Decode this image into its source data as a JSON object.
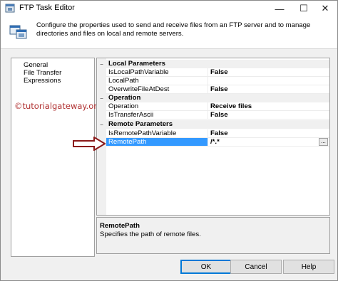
{
  "window": {
    "title": "FTP Task Editor",
    "minimize_glyph": "—",
    "maximize_glyph": "☐",
    "close_glyph": "✕"
  },
  "header": {
    "description": "Configure the properties used to send and receive files from an FTP server and to manage directories and files on local and remote servers."
  },
  "nav": {
    "items": [
      {
        "label": "General"
      },
      {
        "label": "File Transfer"
      },
      {
        "label": "Expressions"
      }
    ]
  },
  "watermark": "©tutorialgateway.org",
  "grid": {
    "categories": [
      {
        "label": "Local Parameters",
        "toggle": "−",
        "props": [
          {
            "name": "IsLocalPathVariable",
            "value": "False"
          },
          {
            "name": "LocalPath",
            "value": ""
          },
          {
            "name": "OverwriteFileAtDest",
            "value": "False"
          }
        ]
      },
      {
        "label": "Operation",
        "toggle": "−",
        "props": [
          {
            "name": "Operation",
            "value": "Receive files"
          },
          {
            "name": "IsTransferAscii",
            "value": "False"
          }
        ]
      },
      {
        "label": "Remote Parameters",
        "toggle": "−",
        "props": [
          {
            "name": "IsRemotePathVariable",
            "value": "False"
          },
          {
            "name": "RemotePath",
            "value": "/*.*",
            "selected": true,
            "ellipsis": "..."
          }
        ]
      }
    ]
  },
  "description_pane": {
    "title": "RemotePath",
    "text": "Specifies the path of remote files."
  },
  "buttons": {
    "ok": "OK",
    "cancel": "Cancel",
    "help": "Help"
  },
  "colors": {
    "selection": "#3399ff",
    "arrow": "#8b1a1a",
    "watermark": "#b03030"
  }
}
